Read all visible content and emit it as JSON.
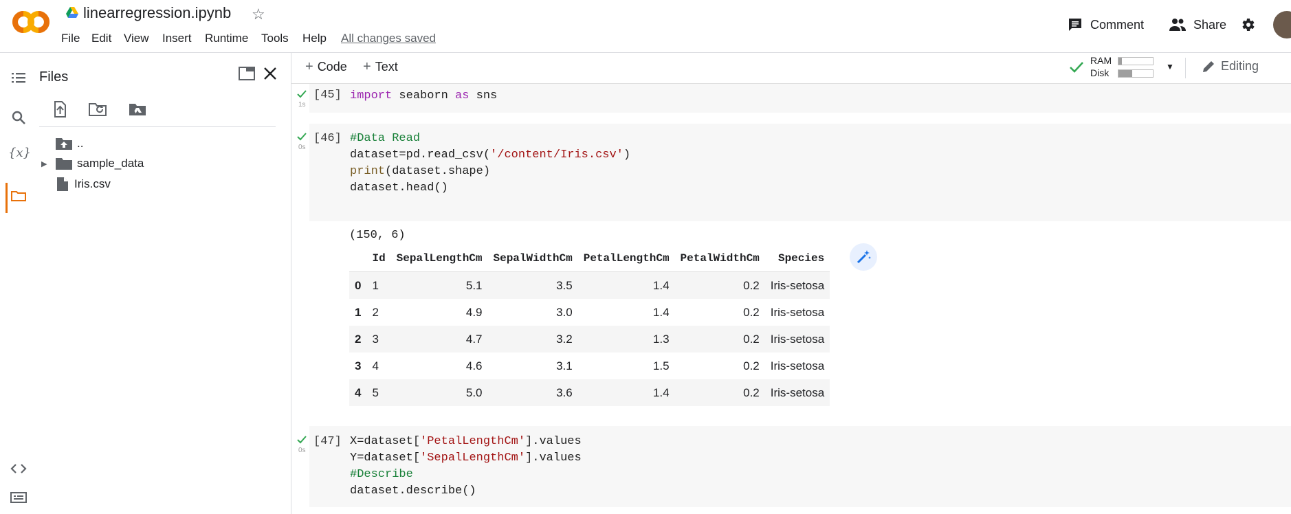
{
  "notebook": {
    "title": "linearregression.ipynb",
    "save_status": "All changes saved"
  },
  "menu": [
    "File",
    "Edit",
    "View",
    "Insert",
    "Runtime",
    "Tools",
    "Help"
  ],
  "header_actions": {
    "comment": "Comment",
    "share": "Share"
  },
  "files_panel": {
    "title": "Files",
    "tree": [
      {
        "label": ".."
      },
      {
        "label": "sample_data"
      },
      {
        "label": "Iris.csv"
      }
    ]
  },
  "toolbar": {
    "add_code": "Code",
    "add_text": "Text",
    "ram": "RAM",
    "disk": "Disk",
    "ram_usage": 0.1,
    "disk_usage": 0.4,
    "mode": "Editing"
  },
  "cells": [
    {
      "exec": "[45]",
      "time": "1s",
      "lines": [
        "import seaborn as sns"
      ]
    },
    {
      "exec": "[46]",
      "time": "0s",
      "lines": [
        "#Data Read",
        "dataset=pd.read_csv('/content/Iris.csv')",
        "print(dataset.shape)",
        "dataset.head()"
      ]
    },
    {
      "exec": "[47]",
      "time": "0s",
      "lines": [
        "X=dataset['PetalLengthCm'].values",
        "Y=dataset['SepalLengthCm'].values",
        "#Describe",
        "dataset.describe()"
      ]
    }
  ],
  "output": {
    "shape": "(150, 6)",
    "columns": [
      "",
      "Id",
      "SepalLengthCm",
      "SepalWidthCm",
      "PetalLengthCm",
      "PetalWidthCm",
      "Species"
    ],
    "rows": [
      [
        "0",
        "1",
        "5.1",
        "3.5",
        "1.4",
        "0.2",
        "Iris-setosa"
      ],
      [
        "1",
        "2",
        "4.9",
        "3.0",
        "1.4",
        "0.2",
        "Iris-setosa"
      ],
      [
        "2",
        "3",
        "4.7",
        "3.2",
        "1.3",
        "0.2",
        "Iris-setosa"
      ],
      [
        "3",
        "4",
        "4.6",
        "3.1",
        "1.5",
        "0.2",
        "Iris-setosa"
      ],
      [
        "4",
        "5",
        "5.0",
        "3.6",
        "1.4",
        "0.2",
        "Iris-setosa"
      ]
    ]
  }
}
